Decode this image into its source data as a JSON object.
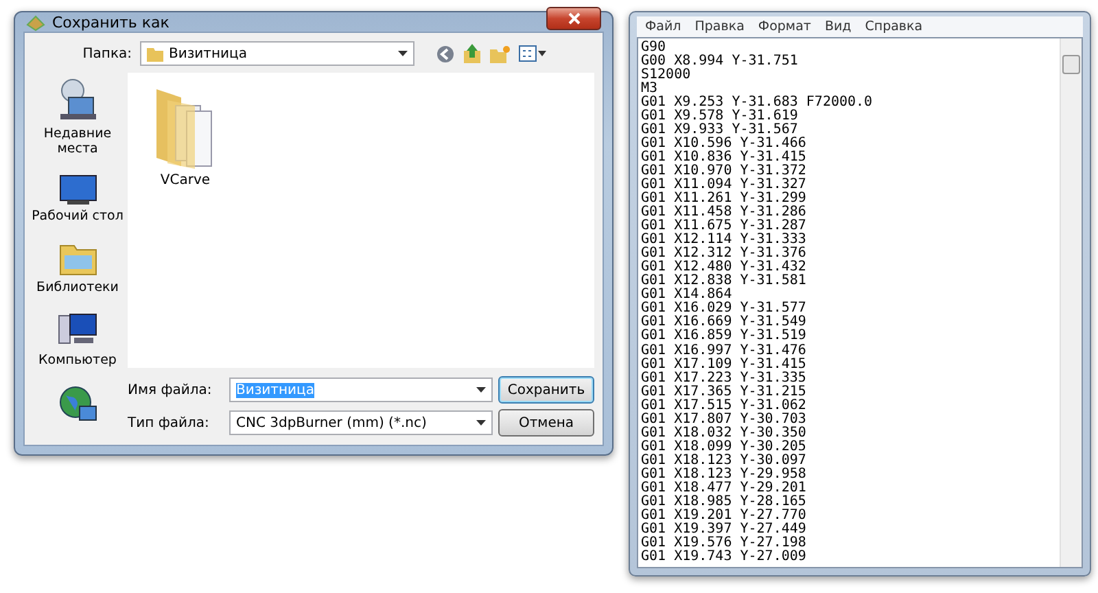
{
  "save_dialog": {
    "title": "Сохранить как",
    "folder_label": "Папка:",
    "folder_value": "Визитница",
    "places": [
      {
        "label": "Недавние места",
        "kind": "recent"
      },
      {
        "label": "Рабочий стол",
        "kind": "desktop"
      },
      {
        "label": "Библиотеки",
        "kind": "libraries"
      },
      {
        "label": "Компьютер",
        "kind": "computer"
      },
      {
        "kind": "network"
      }
    ],
    "files": [
      {
        "name": "VCarve"
      }
    ],
    "filename_label": "Имя файла:",
    "filename_value": "Визитница",
    "filetype_label": "Тип файла:",
    "filetype_value": "CNC 3dpBurner (mm) (*.nc)",
    "buttons": [
      {
        "label": "Сохранить",
        "default": true
      },
      {
        "label": "Отмена",
        "default": false
      }
    ]
  },
  "notepad": {
    "menu": [
      "Файл",
      "Правка",
      "Формат",
      "Вид",
      "Справка"
    ],
    "lines": [
      "G90",
      "G00 X8.994 Y-31.751",
      "S12000",
      "M3",
      "G01 X9.253 Y-31.683 F72000.0",
      "G01 X9.578 Y-31.619",
      "G01 X9.933 Y-31.567",
      "G01 X10.596 Y-31.466",
      "G01 X10.836 Y-31.415",
      "G01 X10.970 Y-31.372",
      "G01 X11.094 Y-31.327",
      "G01 X11.261 Y-31.299",
      "G01 X11.458 Y-31.286",
      "G01 X11.675 Y-31.287",
      "G01 X12.114 Y-31.333",
      "G01 X12.312 Y-31.376",
      "G01 X12.480 Y-31.432",
      "G01 X12.838 Y-31.581",
      "G01 X14.864",
      "G01 X16.029 Y-31.577",
      "G01 X16.669 Y-31.549",
      "G01 X16.859 Y-31.519",
      "G01 X16.997 Y-31.476",
      "G01 X17.109 Y-31.415",
      "G01 X17.223 Y-31.335",
      "G01 X17.365 Y-31.215",
      "G01 X17.515 Y-31.062",
      "G01 X17.807 Y-30.703",
      "G01 X18.032 Y-30.350",
      "G01 X18.099 Y-30.205",
      "G01 X18.123 Y-30.097",
      "G01 X18.123 Y-29.958",
      "G01 X18.477 Y-29.201",
      "G01 X18.985 Y-28.165",
      "G01 X19.201 Y-27.770",
      "G01 X19.397 Y-27.449",
      "G01 X19.576 Y-27.198",
      "G01 X19.743 Y-27.009"
    ]
  }
}
